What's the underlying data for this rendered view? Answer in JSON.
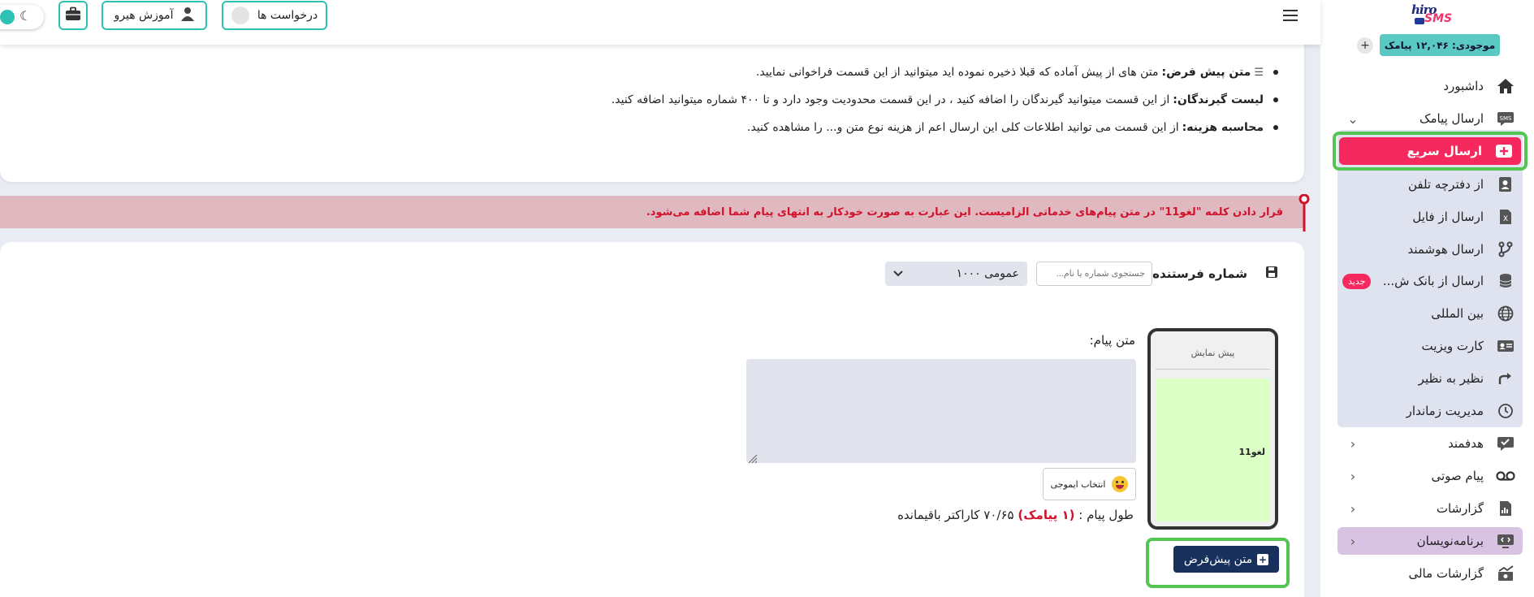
{
  "brand": {
    "logo_line1": "hiro",
    "logo_line2": "SMS"
  },
  "credit": {
    "label": "موجودی: ۱۲,۰۴۶ پیامک",
    "add_symbol": "+"
  },
  "sidebar": {
    "items": [
      {
        "label": "داشبورد",
        "icon": "home-icon"
      },
      {
        "label": "ارسال پیامک",
        "icon": "sms-icon",
        "chevron": "⌄"
      },
      {
        "label": "ارسال سریع",
        "icon": "quick-send-icon",
        "active": true
      },
      {
        "label": "از دفترچه تلفن",
        "icon": "phonebook-icon"
      },
      {
        "label": "ارسال از فایل",
        "icon": "excel-file-icon"
      },
      {
        "label": "ارسال هوشمند",
        "icon": "smart-send-icon"
      },
      {
        "label": "ارسال از بانک ش...",
        "icon": "database-icon",
        "badge": "جدید"
      },
      {
        "label": "بین المللی",
        "icon": "globe-icon"
      },
      {
        "label": "کارت ویزیت",
        "icon": "business-card-icon"
      },
      {
        "label": "نظیر به نظیر",
        "icon": "peer-to-peer-icon"
      },
      {
        "label": "مدیریت زماندار",
        "icon": "timer-icon"
      },
      {
        "label": "هدفمند",
        "icon": "targeted-icon",
        "chevron": "‹"
      },
      {
        "label": "پیام صوتی",
        "icon": "voicemail-icon",
        "chevron": "‹"
      },
      {
        "label": "گزارشات",
        "icon": "reports-icon",
        "chevron": "‹"
      },
      {
        "label": "برنامه‌نویسان",
        "icon": "developers-icon",
        "chevron": "‹"
      },
      {
        "label": "گزارشات مالی",
        "icon": "finance-icon"
      }
    ]
  },
  "topbar": {
    "requests_label": "درخواست ها",
    "training_label": "آموزش هیرو"
  },
  "info": {
    "items": [
      {
        "title": "متن پیش فرض:",
        "text": "متن های از پیش آماده که قبلا ذخیره نموده اید میتوانید از این قسمت فراخوانی نمایید."
      },
      {
        "title": "لیست گیرندگان:",
        "text": "از این قسمت میتوانید گیرندگان را اضافه کنید ، در این قسمت محدودیت وجود دارد و تا ۴۰۰ شماره میتوانید اضافه کنید."
      },
      {
        "title": "محاسبه هزینه:",
        "text": "از این قسمت می توانید اطلاعات کلی این ارسال اعم از هزینه نوع متن و... را مشاهده کنید."
      }
    ]
  },
  "alert": {
    "text": "قرار دادن کلمه \"لغو11\" در متن پیام‌های خدماتی الزامیست. این عبارت به صورت خودکار به انتهای پیام شما اضافه می‌شود."
  },
  "form": {
    "sender_label": "شماره فرستنده :",
    "search_placeholder": "جستجوی شماره یا نام...",
    "sender_selected": "عمومی ۱۰۰۰",
    "preview_title": "پیش نمایش",
    "preview_text": "لغو11",
    "message_label": "متن پیام:",
    "emoji_label": "انتخاب ایموجی",
    "length_prefix": "طول پیام :",
    "length_count": "(۱ پیامک)",
    "length_suffix": "۷۰/۶۵ کاراکتر باقیمانده",
    "default_text_button": "متن پیش‌فرض"
  },
  "colors": {
    "accent_teal": "#2ec2b4",
    "active_pink": "#f5295d",
    "highlight_green": "#54c452",
    "navy_button": "#17305c",
    "alert_bg": "#e0b8c0",
    "alert_text": "#d1122a"
  }
}
